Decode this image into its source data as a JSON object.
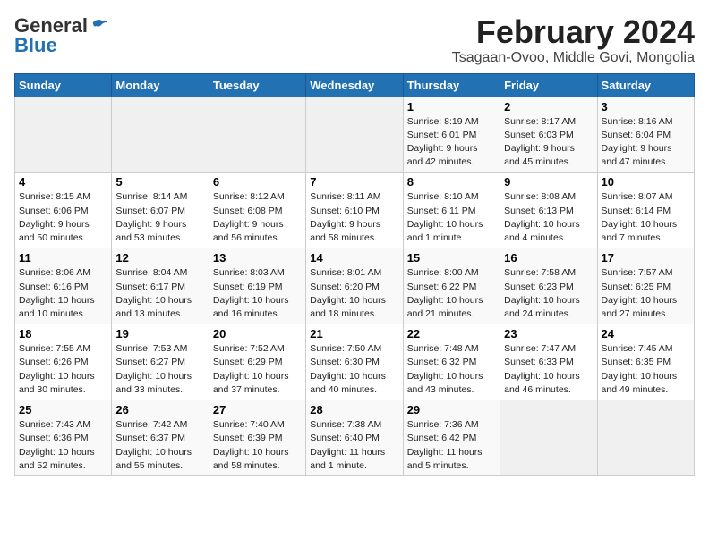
{
  "header": {
    "logo_general": "General",
    "logo_blue": "Blue",
    "month_title": "February 2024",
    "subtitle": "Tsagaan-Ovoo, Middle Govi, Mongolia"
  },
  "days_of_week": [
    "Sunday",
    "Monday",
    "Tuesday",
    "Wednesday",
    "Thursday",
    "Friday",
    "Saturday"
  ],
  "weeks": [
    [
      {
        "day": "",
        "info": ""
      },
      {
        "day": "",
        "info": ""
      },
      {
        "day": "",
        "info": ""
      },
      {
        "day": "",
        "info": ""
      },
      {
        "day": "1",
        "info": "Sunrise: 8:19 AM\nSunset: 6:01 PM\nDaylight: 9 hours\nand 42 minutes."
      },
      {
        "day": "2",
        "info": "Sunrise: 8:17 AM\nSunset: 6:03 PM\nDaylight: 9 hours\nand 45 minutes."
      },
      {
        "day": "3",
        "info": "Sunrise: 8:16 AM\nSunset: 6:04 PM\nDaylight: 9 hours\nand 47 minutes."
      }
    ],
    [
      {
        "day": "4",
        "info": "Sunrise: 8:15 AM\nSunset: 6:06 PM\nDaylight: 9 hours\nand 50 minutes."
      },
      {
        "day": "5",
        "info": "Sunrise: 8:14 AM\nSunset: 6:07 PM\nDaylight: 9 hours\nand 53 minutes."
      },
      {
        "day": "6",
        "info": "Sunrise: 8:12 AM\nSunset: 6:08 PM\nDaylight: 9 hours\nand 56 minutes."
      },
      {
        "day": "7",
        "info": "Sunrise: 8:11 AM\nSunset: 6:10 PM\nDaylight: 9 hours\nand 58 minutes."
      },
      {
        "day": "8",
        "info": "Sunrise: 8:10 AM\nSunset: 6:11 PM\nDaylight: 10 hours\nand 1 minute."
      },
      {
        "day": "9",
        "info": "Sunrise: 8:08 AM\nSunset: 6:13 PM\nDaylight: 10 hours\nand 4 minutes."
      },
      {
        "day": "10",
        "info": "Sunrise: 8:07 AM\nSunset: 6:14 PM\nDaylight: 10 hours\nand 7 minutes."
      }
    ],
    [
      {
        "day": "11",
        "info": "Sunrise: 8:06 AM\nSunset: 6:16 PM\nDaylight: 10 hours\nand 10 minutes."
      },
      {
        "day": "12",
        "info": "Sunrise: 8:04 AM\nSunset: 6:17 PM\nDaylight: 10 hours\nand 13 minutes."
      },
      {
        "day": "13",
        "info": "Sunrise: 8:03 AM\nSunset: 6:19 PM\nDaylight: 10 hours\nand 16 minutes."
      },
      {
        "day": "14",
        "info": "Sunrise: 8:01 AM\nSunset: 6:20 PM\nDaylight: 10 hours\nand 18 minutes."
      },
      {
        "day": "15",
        "info": "Sunrise: 8:00 AM\nSunset: 6:22 PM\nDaylight: 10 hours\nand 21 minutes."
      },
      {
        "day": "16",
        "info": "Sunrise: 7:58 AM\nSunset: 6:23 PM\nDaylight: 10 hours\nand 24 minutes."
      },
      {
        "day": "17",
        "info": "Sunrise: 7:57 AM\nSunset: 6:25 PM\nDaylight: 10 hours\nand 27 minutes."
      }
    ],
    [
      {
        "day": "18",
        "info": "Sunrise: 7:55 AM\nSunset: 6:26 PM\nDaylight: 10 hours\nand 30 minutes."
      },
      {
        "day": "19",
        "info": "Sunrise: 7:53 AM\nSunset: 6:27 PM\nDaylight: 10 hours\nand 33 minutes."
      },
      {
        "day": "20",
        "info": "Sunrise: 7:52 AM\nSunset: 6:29 PM\nDaylight: 10 hours\nand 37 minutes."
      },
      {
        "day": "21",
        "info": "Sunrise: 7:50 AM\nSunset: 6:30 PM\nDaylight: 10 hours\nand 40 minutes."
      },
      {
        "day": "22",
        "info": "Sunrise: 7:48 AM\nSunset: 6:32 PM\nDaylight: 10 hours\nand 43 minutes."
      },
      {
        "day": "23",
        "info": "Sunrise: 7:47 AM\nSunset: 6:33 PM\nDaylight: 10 hours\nand 46 minutes."
      },
      {
        "day": "24",
        "info": "Sunrise: 7:45 AM\nSunset: 6:35 PM\nDaylight: 10 hours\nand 49 minutes."
      }
    ],
    [
      {
        "day": "25",
        "info": "Sunrise: 7:43 AM\nSunset: 6:36 PM\nDaylight: 10 hours\nand 52 minutes."
      },
      {
        "day": "26",
        "info": "Sunrise: 7:42 AM\nSunset: 6:37 PM\nDaylight: 10 hours\nand 55 minutes."
      },
      {
        "day": "27",
        "info": "Sunrise: 7:40 AM\nSunset: 6:39 PM\nDaylight: 10 hours\nand 58 minutes."
      },
      {
        "day": "28",
        "info": "Sunrise: 7:38 AM\nSunset: 6:40 PM\nDaylight: 11 hours\nand 1 minute."
      },
      {
        "day": "29",
        "info": "Sunrise: 7:36 AM\nSunset: 6:42 PM\nDaylight: 11 hours\nand 5 minutes."
      },
      {
        "day": "",
        "info": ""
      },
      {
        "day": "",
        "info": ""
      }
    ]
  ]
}
